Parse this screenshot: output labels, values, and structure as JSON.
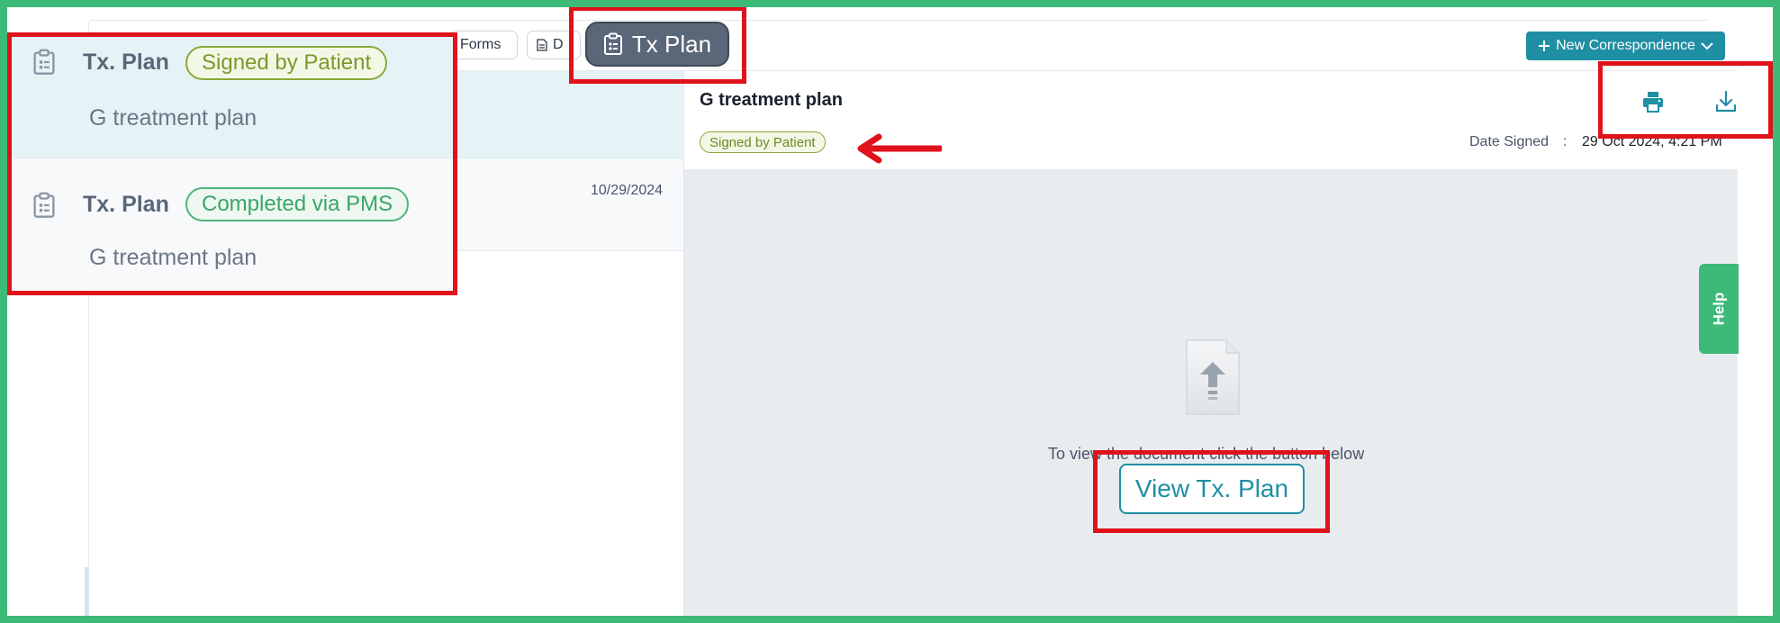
{
  "toolbar": {
    "forms_label": "Forms",
    "docs_label": "D",
    "tx_plan_label": "Tx Plan",
    "new_correspondence_label": "New Correspondence"
  },
  "list": {
    "rows": [
      {
        "type": "Tx. Plan",
        "status": "Signed by Patient",
        "title": "G treatment plan",
        "date": ""
      },
      {
        "type": "Tx. Plan",
        "status": "Completed via PMS",
        "title": "G treatment plan",
        "date": "10/29/2024"
      }
    ]
  },
  "detail": {
    "title": "G treatment plan",
    "status": "Signed by Patient",
    "date_signed_label": "Date Signed",
    "date_separator": ":",
    "date_signed_value": "29 Oct 2024, 4:21 PM",
    "view_message": "To view the document click the button below",
    "view_button_label": "View Tx. Plan"
  },
  "help": {
    "label": "Help"
  },
  "colors": {
    "accent": "#1f8fa3",
    "frame": "#3dba78",
    "annotation": "#e0121b",
    "signed": "#7a9a2a",
    "completed": "#3aa566"
  },
  "icons": [
    "clipboard-icon",
    "document-icon",
    "plus-icon",
    "chevron-down-icon",
    "print-icon",
    "download-icon",
    "file-upload-icon",
    "arrow-left-icon"
  ]
}
